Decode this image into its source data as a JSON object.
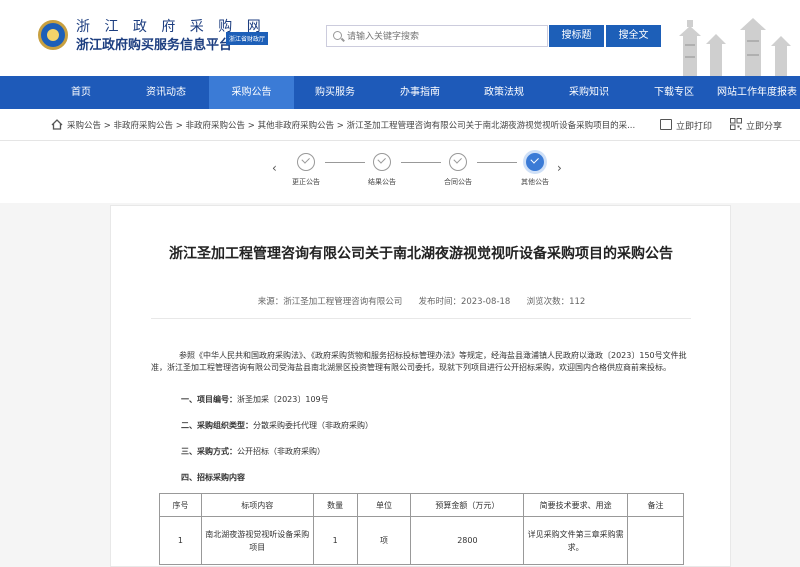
{
  "header": {
    "logo_line1": "浙 江 政 府 采 购 网",
    "logo_line2": "浙江政府购买服务信息平台",
    "logo_badge": "浙江省财政厅",
    "search_placeholder": "请输入关键字搜索",
    "search_title_btn": "搜标题",
    "search_full_btn": "搜全文"
  },
  "nav": {
    "items": [
      "首页",
      "资讯动态",
      "采购公告",
      "购买服务",
      "办事指南",
      "政策法规",
      "采购知识",
      "下载专区",
      "网站工作年度报表"
    ],
    "active": "采购公告"
  },
  "breadcrumb": {
    "path": "采购公告 > 非政府采购公告 > 非政府采购公告 > 其他非政府采购公告 > 浙江圣加工程管理咨询有限公司关于南北湖夜游视觉视听设备采购项目的采...",
    "print": "立即打印",
    "share": "立即分享"
  },
  "steps": [
    "更正公告",
    "结果公告",
    "合同公告",
    "其他公告"
  ],
  "article": {
    "title": "浙江圣加工程管理咨询有限公司关于南北湖夜游视觉视听设备采购项目的采购公告",
    "source": "来源：浙江圣加工程管理咨询有限公司",
    "publish_time": "发布时间：2023-08-18",
    "views": "浏览次数：112",
    "intro": "参照《中华人民共和国政府采购法》、《政府采购货物和服务招标投标管理办法》等规定，经海盐县澉浦镇人民政府以澉政〔2023〕150号文件批准，浙江圣加工程管理咨询有限公司受海盐县南北湖景区投资管理有限公司委托，现就下列项目进行公开招标采购，欢迎国内合格供应商前来投标。",
    "items": [
      {
        "label": "一、项目编号：",
        "value": "浙圣加采〔2023〕109号"
      },
      {
        "label": "二、采购组织类型：",
        "value": "分散采购委托代理（非政府采购）"
      },
      {
        "label": "三、采购方式：",
        "value": "公开招标（非政府采购）"
      }
    ],
    "section4": "四、招标采购内容",
    "table": {
      "headers": [
        "序号",
        "标项内容",
        "数量",
        "单位",
        "预算金额（万元）",
        "简要技术要求、用途",
        "备注"
      ],
      "rows": [
        [
          "1",
          "南北湖夜游视觉视听设备采购项目",
          "1",
          "项",
          "2800",
          "详见采购文件第三章采购需求。",
          ""
        ]
      ]
    }
  }
}
